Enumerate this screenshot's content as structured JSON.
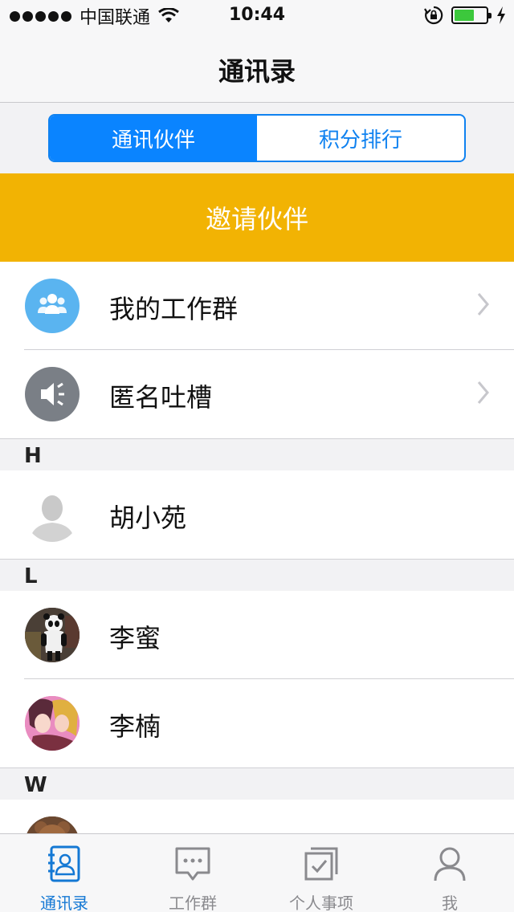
{
  "status_bar": {
    "carrier": "中国联通",
    "time": "10:44",
    "battery_level": 0.62
  },
  "nav": {
    "title": "通讯录"
  },
  "segment": {
    "items": [
      {
        "label": "通讯伙伴",
        "active": true
      },
      {
        "label": "积分排行",
        "active": false
      }
    ]
  },
  "invite": {
    "label": "邀请伙伴"
  },
  "groups": [
    {
      "label": "我的工作群",
      "icon": "group-icon"
    },
    {
      "label": "匿名吐槽",
      "icon": "speaker-icon"
    }
  ],
  "sections": [
    {
      "letter": "H",
      "contacts": [
        {
          "name": "胡小苑",
          "avatar": "default-avatar"
        }
      ]
    },
    {
      "letter": "L",
      "contacts": [
        {
          "name": "李蜜",
          "avatar": "panda-avatar"
        },
        {
          "name": "李楠",
          "avatar": "anime-avatar"
        }
      ]
    },
    {
      "letter": "W",
      "contacts": [
        {
          "name": "",
          "avatar": "bear-avatar"
        }
      ]
    }
  ],
  "tabs": [
    {
      "label": "通讯录",
      "icon": "contacts-icon",
      "active": true
    },
    {
      "label": "工作群",
      "icon": "chat-icon",
      "active": false
    },
    {
      "label": "个人事项",
      "icon": "todo-icon",
      "active": false
    },
    {
      "label": "我",
      "icon": "person-icon",
      "active": false
    }
  ],
  "colors": {
    "accent": "#0a84ff",
    "invite": "#f2b303",
    "group_icon": "#5ab4f0",
    "speaker_icon": "#7a7f86"
  }
}
